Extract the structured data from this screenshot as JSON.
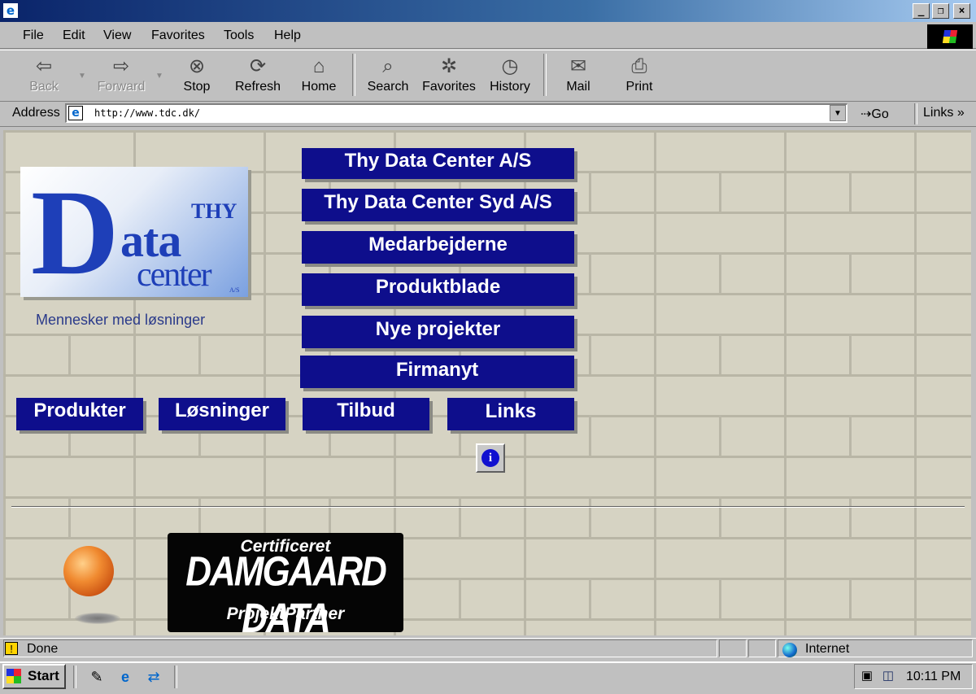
{
  "window": {
    "minimize": "_",
    "maximize": "❐",
    "close": "×"
  },
  "menu": [
    "File",
    "Edit",
    "View",
    "Favorites",
    "Tools",
    "Help"
  ],
  "toolbar": {
    "back": "Back",
    "forward": "Forward",
    "stop": "Stop",
    "refresh": "Refresh",
    "home": "Home",
    "search": "Search",
    "favorites": "Favorites",
    "history": "History",
    "mail": "Mail",
    "print": "Print"
  },
  "address": {
    "label": "Address",
    "url": "http://www.tdc.dk/",
    "go": "Go",
    "links": "Links"
  },
  "logo": {
    "thy": "THY",
    "d": "D",
    "ata": "ata",
    "center": "center",
    "as": "A/S",
    "tagline": "Mennesker med løsninger"
  },
  "nav": {
    "thy_data_center": "Thy Data Center A/S",
    "thy_data_center_syd": "Thy Data Center Syd A/S",
    "medarbejderne": "Medarbejderne",
    "produktblade": "Produktblade",
    "nye_projekter": "Nye projekter",
    "firmanyt": "Firmanyt",
    "produkter": "Produkter",
    "losninger": "Løsninger",
    "tilbud": "Tilbud",
    "links": "Links",
    "info": "i"
  },
  "certificate": {
    "top": "Certificeret",
    "main": "DAMGAARD DATA",
    "bottom": "ProjektPartner"
  },
  "status": {
    "text": "Done",
    "zone": "Internet"
  },
  "taskbar": {
    "start": "Start",
    "clock": "10:11 PM"
  },
  "colors": {
    "nav_bg": "#0e0e8c",
    "logo_blue": "#1e3fb8",
    "titlebar": "#0a246a"
  }
}
